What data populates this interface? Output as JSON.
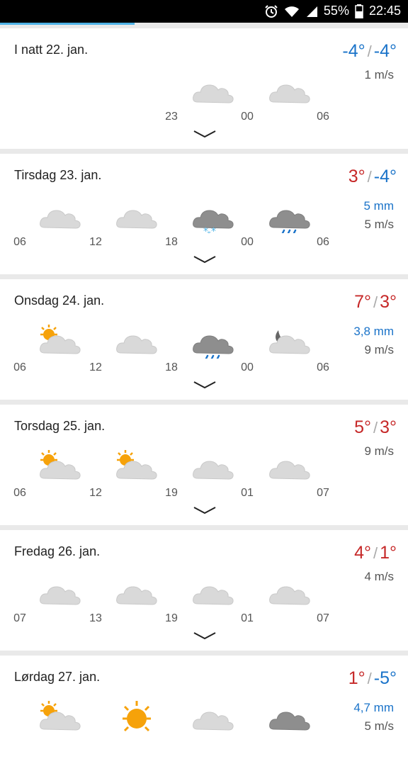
{
  "status": {
    "battery": "55%",
    "time": "22:45"
  },
  "cards": [
    {
      "title": "I natt 22. jan.",
      "high": "-4°",
      "low": "-4°",
      "highColor": "cold",
      "precip": "",
      "wind": "1 m/s",
      "hours": [
        "23",
        "00",
        "06"
      ],
      "icons": [
        "cloud",
        "cloud"
      ]
    },
    {
      "title": "Tirsdag 23. jan.",
      "high": "3°",
      "low": "-4°",
      "highColor": "hot",
      "precip": "5 mm",
      "wind": "5 m/s",
      "hours": [
        "06",
        "12",
        "18",
        "00",
        "06"
      ],
      "icons": [
        "cloud",
        "cloud",
        "cloud-snow",
        "cloud-rain"
      ]
    },
    {
      "title": "Onsdag 24. jan.",
      "high": "7°",
      "low": "3°",
      "highColor": "hot",
      "lowColor": "hot",
      "precip": "3,8 mm",
      "wind": "9 m/s",
      "hours": [
        "06",
        "12",
        "18",
        "00",
        "06"
      ],
      "icons": [
        "sun-cloud",
        "cloud",
        "cloud-rain",
        "moon-cloud"
      ]
    },
    {
      "title": "Torsdag 25. jan.",
      "high": "5°",
      "low": "3°",
      "highColor": "hot",
      "lowColor": "hot",
      "precip": "",
      "wind": "9 m/s",
      "hours": [
        "06",
        "12",
        "19",
        "01",
        "07"
      ],
      "icons": [
        "sun-cloud",
        "sun-cloud",
        "cloud",
        "cloud"
      ]
    },
    {
      "title": "Fredag 26. jan.",
      "high": "4°",
      "low": "1°",
      "highColor": "hot",
      "lowColor": "hot",
      "precip": "",
      "wind": "4 m/s",
      "hours": [
        "07",
        "13",
        "19",
        "01",
        "07"
      ],
      "icons": [
        "cloud",
        "cloud",
        "cloud",
        "cloud"
      ]
    },
    {
      "title": "Lørdag 27. jan.",
      "high": "1°",
      "low": "-5°",
      "highColor": "hot",
      "precip": "4,7 mm",
      "wind": "5 m/s",
      "hours": [],
      "icons": [
        "sun-cloud",
        "sun",
        "cloud",
        "cloud-dark"
      ]
    }
  ]
}
